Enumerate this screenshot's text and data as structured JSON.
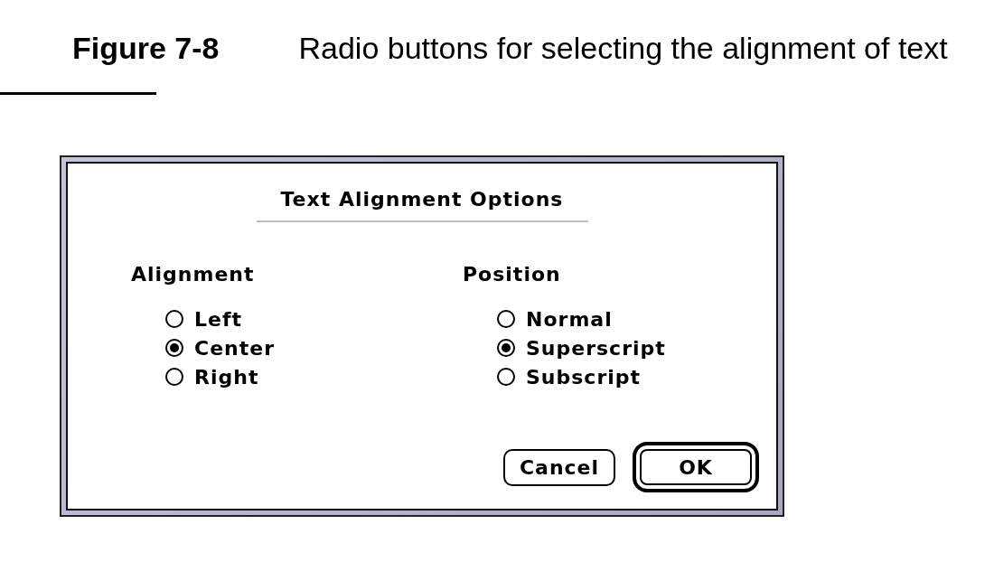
{
  "figure": {
    "label": "Figure 7-8",
    "title": "Radio buttons for selecting the alignment of text"
  },
  "dialog": {
    "title": "Text Alignment Options",
    "groups": [
      {
        "label": "Alignment",
        "options": [
          {
            "label": "Left",
            "selected": false
          },
          {
            "label": "Center",
            "selected": true
          },
          {
            "label": "Right",
            "selected": false
          }
        ]
      },
      {
        "label": "Position",
        "options": [
          {
            "label": "Normal",
            "selected": false
          },
          {
            "label": "Superscript",
            "selected": true
          },
          {
            "label": "Subscript",
            "selected": false
          }
        ]
      }
    ],
    "buttons": [
      {
        "label": "Cancel",
        "default": false
      },
      {
        "label": "OK",
        "default": true
      }
    ]
  }
}
